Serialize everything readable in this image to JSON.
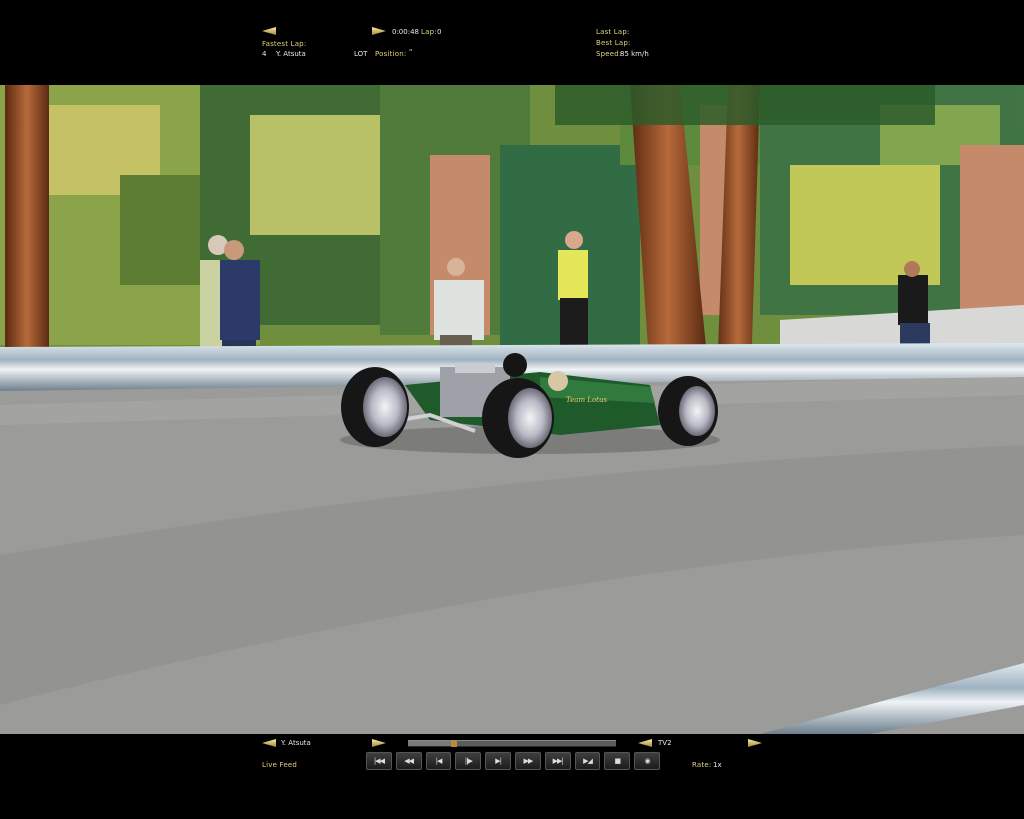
{
  "hud_top": {
    "fastest_lap_label": "Fastest Lap:",
    "driver_number": "4",
    "driver_name": "Y. Atsuta",
    "team": "LOT",
    "position_label": "Position:",
    "position_value": "\"",
    "time": "0:00:48",
    "lap_label": "Lap:",
    "lap_value": "0",
    "last_lap_label": "Last Lap:",
    "best_lap_label": "Best Lap:",
    "speed_label": "Speed:",
    "speed_value": "85 km/h"
  },
  "car": {
    "livery_text": "Team Lotus"
  },
  "hud_bottom": {
    "driver_name": "Y. Atsuta",
    "camera": "TV2",
    "live_feed_label": "Live Feed",
    "rate_label": "Rate:",
    "rate_value": "1x",
    "replay_progress": 0.22,
    "controls": [
      "|◀◀",
      "◀◀",
      "|◀",
      "||▶",
      "▶|",
      "▶▶",
      "▶▶|",
      "▶◢",
      "■",
      "◉"
    ]
  },
  "colors": {
    "hud_label": "#e2d27a",
    "car_green": "#1f5a2b",
    "track": "#9b9b99"
  }
}
